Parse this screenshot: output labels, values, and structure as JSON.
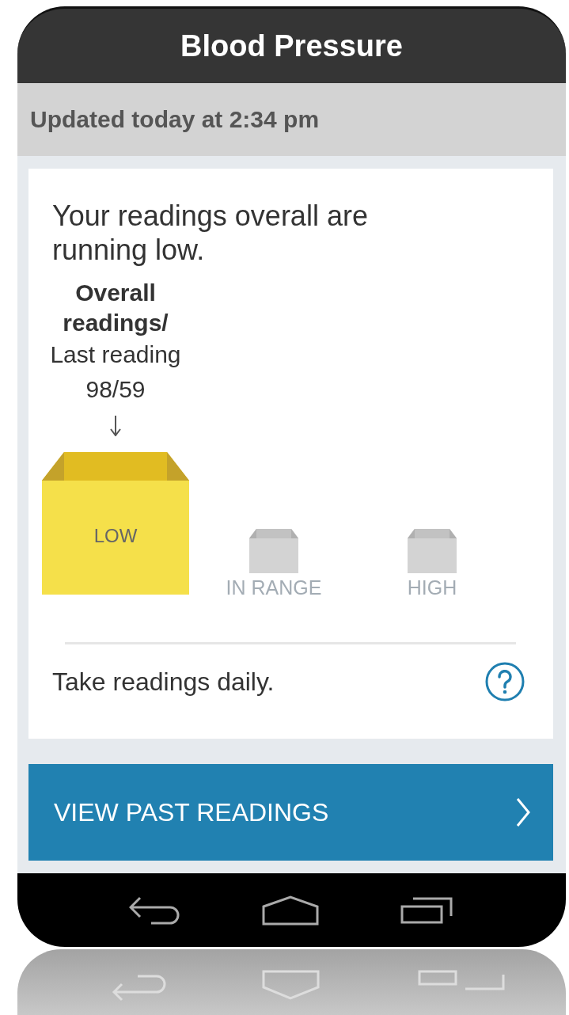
{
  "header": {
    "title": "Blood Pressure"
  },
  "status": {
    "updated": "Updated today at 2:34 pm"
  },
  "summary": {
    "message": "Your readings overall are running low.",
    "reading_title": "Overall readings/",
    "reading_label": "Last reading",
    "reading_value": "98/59",
    "categories": [
      {
        "label": "LOW",
        "selected": true
      },
      {
        "label": "IN RANGE",
        "selected": false
      },
      {
        "label": "HIGH",
        "selected": false
      }
    ],
    "advice": "Take readings daily."
  },
  "action": {
    "label": "VIEW PAST READINGS"
  }
}
